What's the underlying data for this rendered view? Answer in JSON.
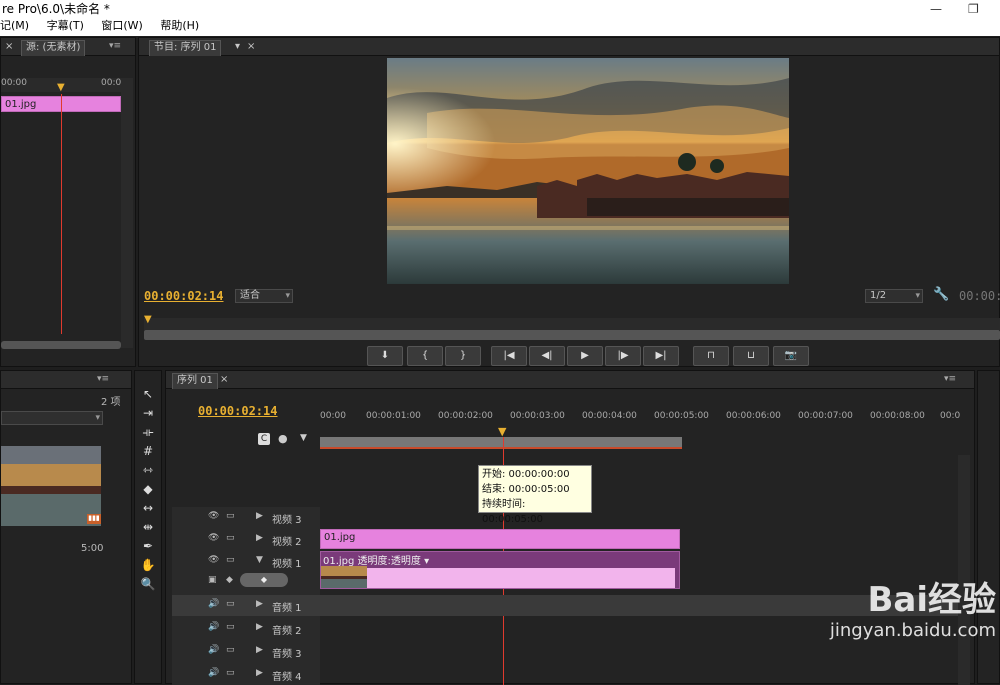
{
  "title": {
    "text": "re Pro\\6.0\\未命名 *"
  },
  "menu": [
    "记(M)",
    "字幕(T)",
    "窗口(W)",
    "帮助(H)"
  ],
  "source_panel": {
    "tab_label": "源: (无素材)",
    "ruler_start": "00:00",
    "ruler_end": "00:0",
    "clip_label": "01.jpg"
  },
  "program_panel": {
    "tab_label": "节目: 序列 01",
    "timecode": "00:00:02:14",
    "timecode_right": "00:00:",
    "fit_label": "适合",
    "resolution_label": "1/2"
  },
  "project_panel": {
    "item_count": "2 项",
    "duration": "5:00"
  },
  "transport_buttons": [
    "marker-icon",
    "in-point-icon",
    "out-point-icon",
    "go-to-in-icon",
    "step-back-icon",
    "play-icon",
    "step-forward-icon",
    "go-to-out-icon",
    "lift-icon",
    "extract-icon",
    "export-frame-icon"
  ],
  "tools": [
    "selection-tool-icon",
    "track-select-tool-icon",
    "ripple-edit-tool-icon",
    "rolling-edit-tool-icon",
    "rate-stretch-tool-icon",
    "razor-tool-icon",
    "slip-tool-icon",
    "slide-tool-icon",
    "pen-tool-icon",
    "hand-tool-icon",
    "zoom-tool-icon"
  ],
  "timeline": {
    "tab_label": "序列 01",
    "timecode": "00:00:02:14",
    "ruler": [
      "00:00",
      "00:00:01:00",
      "00:00:02:00",
      "00:00:03:00",
      "00:00:04:00",
      "00:00:05:00",
      "00:00:06:00",
      "00:00:07:00",
      "00:00:08:00",
      "00:0"
    ],
    "tooltip": {
      "start": "开始: 00:00:00:00",
      "end": "结束: 00:00:05:00",
      "duration": "持续时间: 00:00:05:00"
    },
    "video_tracks": [
      "视频 3",
      "视频 2",
      "视频 1"
    ],
    "audio_tracks": [
      "音频 1",
      "音频 2",
      "音频 3",
      "音频 4"
    ],
    "clip_v2": "01.jpg",
    "clip_v1": "01.jpg  透明度:透明度 ▾"
  },
  "watermark": {
    "brand": "Bai经验",
    "url": "jingyan.baidu.com"
  },
  "colors": {
    "accent_orange": "#e8b031",
    "clip_pink": "#e682de",
    "playhead_red": "#e03a2e",
    "bg": "#232323"
  }
}
